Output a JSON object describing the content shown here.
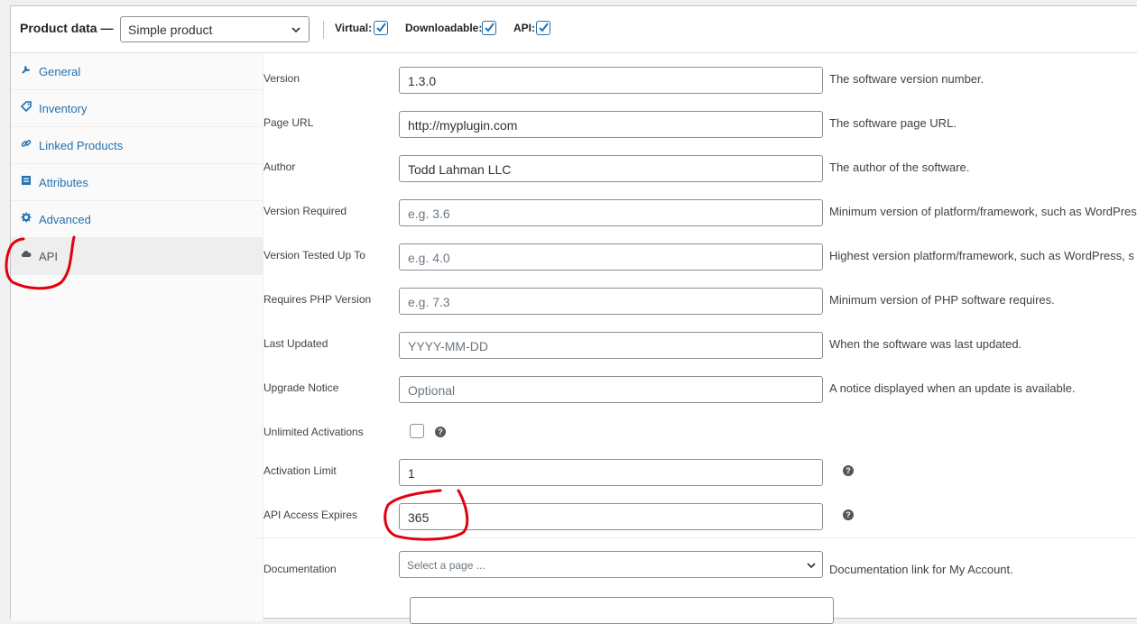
{
  "header": {
    "label": "Product data —",
    "product_type": "Simple product",
    "options": [
      {
        "label": "Virtual:",
        "checked": true
      },
      {
        "label": "Downloadable:",
        "checked": true
      },
      {
        "label": "API:",
        "checked": true
      }
    ]
  },
  "sidebar": {
    "items": [
      {
        "label": "General",
        "icon": "wrench-icon"
      },
      {
        "label": "Inventory",
        "icon": "tag-icon"
      },
      {
        "label": "Linked Products",
        "icon": "link-icon"
      },
      {
        "label": "Attributes",
        "icon": "list-icon"
      },
      {
        "label": "Advanced",
        "icon": "gear-icon"
      },
      {
        "label": "API",
        "icon": "cloud-icon",
        "active": true
      }
    ]
  },
  "form": {
    "version": {
      "label": "Version",
      "value": "1.3.0",
      "desc": "The software version number."
    },
    "page_url": {
      "label": "Page URL",
      "value": "http://myplugin.com",
      "desc": "The software page URL."
    },
    "author": {
      "label": "Author",
      "value": "Todd Lahman LLC",
      "desc": "The author of the software."
    },
    "version_required": {
      "label": "Version Required",
      "placeholder": "e.g. 3.6",
      "desc": "Minimum version of platform/framework, such as WordPress"
    },
    "version_tested": {
      "label": "Version Tested Up To",
      "placeholder": "e.g. 4.0",
      "desc": "Highest version platform/framework, such as WordPress, s"
    },
    "requires_php": {
      "label": "Requires PHP Version",
      "placeholder": "e.g. 7.3",
      "desc": "Minimum version of PHP software requires."
    },
    "last_updated": {
      "label": "Last Updated",
      "placeholder": "YYYY-MM-DD",
      "desc": "When the software was last updated."
    },
    "upgrade_notice": {
      "label": "Upgrade Notice",
      "placeholder": "Optional",
      "desc": "A notice displayed when an update is available."
    },
    "unlimited_activations": {
      "label": "Unlimited Activations",
      "checked": false
    },
    "activation_limit": {
      "label": "Activation Limit",
      "value": "1"
    },
    "api_access_expires": {
      "label": "API Access Expires",
      "value": "365"
    },
    "documentation": {
      "label": "Documentation",
      "placeholder": "Select a page ...",
      "desc": "Documentation link for My Account."
    }
  },
  "colors": {
    "link": "#2271b1",
    "annotation": "#e3000f",
    "checkbox": "#2271b1"
  }
}
